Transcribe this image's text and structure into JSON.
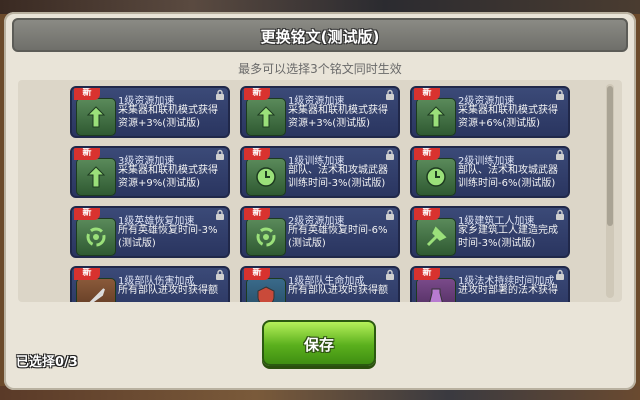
{
  "title": "更换铭文(测试版)",
  "subtitle": "最多可以选择3个铭文同时生效",
  "selected": "已选择0/3",
  "save_label": "保存",
  "badge_label": "新",
  "cards": [
    {
      "name": "1级资源加速",
      "desc": "采集器和联机模式获得资源+3%(测试版)",
      "icon": "arrows-up-icon"
    },
    {
      "name": "1级资源加速",
      "desc": "采集器和联机模式获得资源+3%(测试版)",
      "icon": "arrows-up-icon"
    },
    {
      "name": "2级资源加速",
      "desc": "采集器和联机模式获得资源+6%(测试版)",
      "icon": "arrows-up-icon"
    },
    {
      "name": "3级资源加速",
      "desc": "采集器和联机模式获得资源+9%(测试版)",
      "icon": "arrows-up-icon"
    },
    {
      "name": "1级训练加速",
      "desc": "部队、法术和攻城武器训练时间-3%(测试版)",
      "icon": "clock-icon"
    },
    {
      "name": "2级训练加速",
      "desc": "部队、法术和攻城武器训练时间-6%(测试版)",
      "icon": "clock-icon"
    },
    {
      "name": "1级英雄恢复加速",
      "desc": "所有英雄恢复时间-3%(测试版)",
      "icon": "recycle-icon"
    },
    {
      "name": "2级资源加速",
      "desc": "所有英雄恢复时间-6%(测试版)",
      "icon": "recycle-icon"
    },
    {
      "name": "1级建筑工人加速",
      "desc": "家乡建筑工人建造完成时间-3%(测试版)",
      "icon": "builder-icon"
    },
    {
      "name": "1级部队伤害加成",
      "desc": "所有部队进攻时获得额",
      "icon": "sword-icon"
    },
    {
      "name": "1级部队生命加成",
      "desc": "所有部队进攻时获得额",
      "icon": "shield-icon"
    },
    {
      "name": "1级法术持续时间加成",
      "desc": "进攻时部署的法术获得",
      "icon": "spell-icon"
    }
  ],
  "colors": {
    "badge": "#d8322f",
    "card": "#2f3b68",
    "save": "#5bb01d"
  }
}
